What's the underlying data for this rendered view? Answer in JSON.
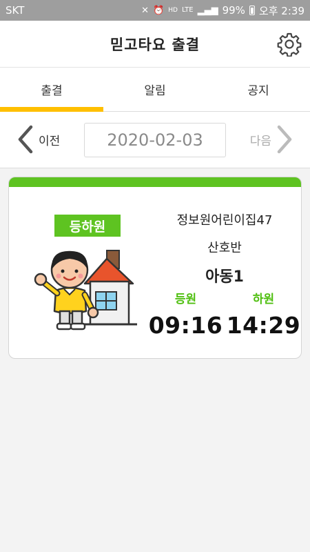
{
  "status_bar": {
    "carrier": "SKT",
    "icons": [
      "mute-icon",
      "alarm-icon",
      "hd-voice-icon",
      "lte-icon",
      "signal-icon"
    ],
    "battery": "99%",
    "time": "오후 2:39"
  },
  "app_bar": {
    "title": "믿고타요 출결",
    "settings_icon": "gear-icon"
  },
  "tabs": [
    {
      "label": "출결",
      "active": true
    },
    {
      "label": "알림",
      "active": false
    },
    {
      "label": "공지",
      "active": false
    }
  ],
  "date_nav": {
    "prev_label": "이전",
    "date": "2020-02-03",
    "next_label": "다음"
  },
  "card": {
    "badge": "등하원",
    "center_name": "정보원어린이집47",
    "class_name": "산호반",
    "child_name": "아동1",
    "arrival_label": "등원",
    "arrival_time": "09:16",
    "departure_label": "하원",
    "departure_time": "14:29",
    "accent_color": "#5ec321"
  },
  "colors": {
    "tab_indicator": "#ffbf00",
    "accent_green": "#5ec321"
  }
}
